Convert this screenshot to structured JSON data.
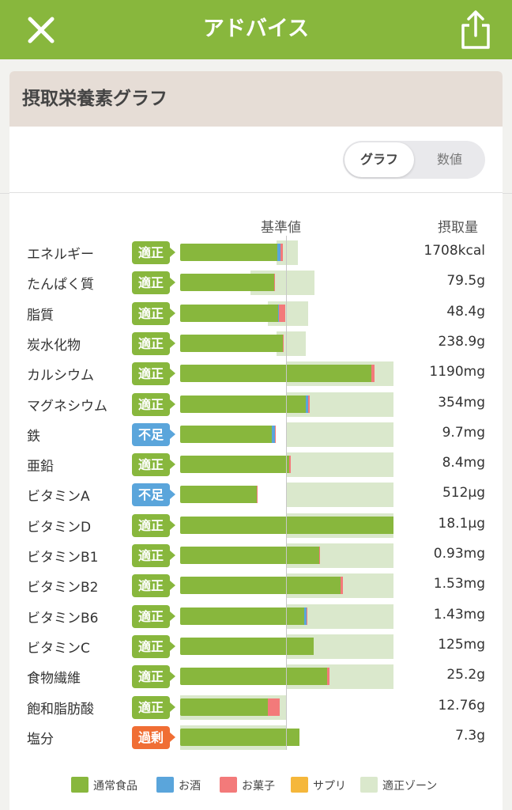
{
  "header": {
    "title": "アドバイス",
    "close_icon": "close-icon",
    "share_icon": "share-icon"
  },
  "card": {
    "title": "摂取栄養素グラフ",
    "toggle": {
      "graph_label": "グラフ",
      "number_label": "数値",
      "selected": "グラフ"
    },
    "col_standard": "基準値",
    "col_amount": "摂取量"
  },
  "colors": {
    "header": "#88b73d",
    "normal_food": "#88b73d",
    "alcohol": "#5aa5db",
    "snack": "#f37a7a",
    "supplement": "#f5b73b",
    "zone": "#dae8cc",
    "badge_ok": "#88b73d",
    "badge_low": "#5aa5db",
    "badge_over": "#f06e34"
  },
  "chart_data": {
    "type": "bar",
    "standard_level": 0.5,
    "rows": [
      {
        "name": "エネルギー",
        "status": "適正",
        "status_kind": "ok",
        "amount": "1708kcal",
        "zone": [
          0.45,
          0.55
        ],
        "food": 0.455,
        "alcohol": 0.015,
        "snack": 0.01
      },
      {
        "name": "たんぱく質",
        "status": "適正",
        "status_kind": "ok",
        "amount": "79.5g",
        "zone": [
          0.33,
          0.63
        ],
        "food": 0.44,
        "alcohol": 0,
        "snack": 0.005
      },
      {
        "name": "脂質",
        "status": "適正",
        "status_kind": "ok",
        "amount": "48.4g",
        "zone": [
          0.41,
          0.6
        ],
        "food": 0.46,
        "alcohol": 0.003,
        "snack": 0.03
      },
      {
        "name": "炭水化物",
        "status": "適正",
        "status_kind": "ok",
        "amount": "238.9g",
        "zone": [
          0.45,
          0.59
        ],
        "food": 0.48,
        "alcohol": 0,
        "snack": 0.007
      },
      {
        "name": "カルシウム",
        "status": "適正",
        "status_kind": "ok",
        "amount": "1190mg",
        "zone": [
          0.5,
          1.0
        ],
        "food": 0.895,
        "alcohol": 0,
        "snack": 0.015
      },
      {
        "name": "マグネシウム",
        "status": "適正",
        "status_kind": "ok",
        "amount": "354mg",
        "zone": [
          0.5,
          1.0
        ],
        "food": 0.59,
        "alcohol": 0.01,
        "snack": 0.008
      },
      {
        "name": "鉄",
        "status": "不足",
        "status_kind": "low",
        "amount": "9.7mg",
        "zone": [
          0.5,
          1.0
        ],
        "food": 0.43,
        "alcohol": 0.015,
        "snack": 0.005
      },
      {
        "name": "亜鉛",
        "status": "適正",
        "status_kind": "ok",
        "amount": "8.4mg",
        "zone": [
          0.5,
          1.0
        ],
        "food": 0.51,
        "alcohol": 0,
        "snack": 0.008
      },
      {
        "name": "ビタミンA",
        "status": "不足",
        "status_kind": "low",
        "amount": "512µg",
        "zone": [
          0.5,
          1.0
        ],
        "food": 0.36,
        "alcohol": 0,
        "snack": 0.004
      },
      {
        "name": "ビタミンD",
        "status": "適正",
        "status_kind": "ok",
        "amount": "18.1µg",
        "zone": [
          0.5,
          1.0
        ],
        "food": 1.0,
        "alcohol": 0,
        "snack": 0
      },
      {
        "name": "ビタミンB1",
        "status": "適正",
        "status_kind": "ok",
        "amount": "0.93mg",
        "zone": [
          0.5,
          1.0
        ],
        "food": 0.65,
        "alcohol": 0,
        "snack": 0.007
      },
      {
        "name": "ビタミンB2",
        "status": "適正",
        "status_kind": "ok",
        "amount": "1.53mg",
        "zone": [
          0.5,
          1.0
        ],
        "food": 0.75,
        "alcohol": 0,
        "snack": 0.012
      },
      {
        "name": "ビタミンB6",
        "status": "適正",
        "status_kind": "ok",
        "amount": "1.43mg",
        "zone": [
          0.5,
          1.0
        ],
        "food": 0.58,
        "alcohol": 0.012,
        "snack": 0.005
      },
      {
        "name": "ビタミンC",
        "status": "適正",
        "status_kind": "ok",
        "amount": "125mg",
        "zone": [
          0.5,
          1.0
        ],
        "food": 0.625,
        "alcohol": 0,
        "snack": 0
      },
      {
        "name": "食物繊維",
        "status": "適正",
        "status_kind": "ok",
        "amount": "25.2g",
        "zone": [
          0.5,
          1.0
        ],
        "food": 0.69,
        "alcohol": 0,
        "snack": 0.01
      },
      {
        "name": "飽和脂肪酸",
        "status": "適正",
        "status_kind": "ok",
        "amount": "12.76g",
        "zone": [
          0.0,
          0.5
        ],
        "food": 0.41,
        "alcohol": 0,
        "snack": 0.055
      },
      {
        "name": "塩分",
        "status": "過剰",
        "status_kind": "over",
        "amount": "7.3g",
        "zone": [
          0.0,
          0.5
        ],
        "food": 0.56,
        "alcohol": 0,
        "snack": 0
      }
    ]
  },
  "legend": [
    {
      "label": "通常食品",
      "color": "#88b73d"
    },
    {
      "label": "お酒",
      "color": "#5aa5db"
    },
    {
      "label": "お菓子",
      "color": "#f37a7a"
    },
    {
      "label": "サプリ",
      "color": "#f5b73b"
    },
    {
      "label": "適正ゾーン",
      "color": "#dae8cc"
    }
  ]
}
